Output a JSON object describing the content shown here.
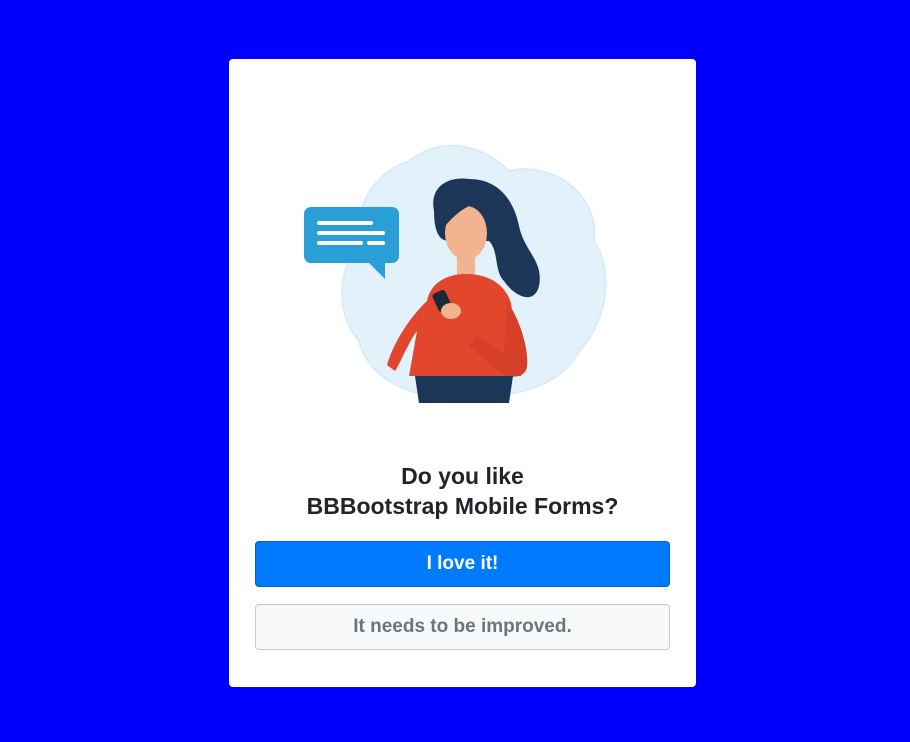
{
  "colors": {
    "background": "#0000ff",
    "card": "#ffffff",
    "primary_button": "#007bff",
    "secondary_button": "#f8f9fa",
    "text": "#212529"
  },
  "illustration": {
    "icon": "woman-with-phone-and-chat-bubble-illustration"
  },
  "question": {
    "line1": "Do you like",
    "line2": "BBBootstrap Mobile Forms?"
  },
  "actions": {
    "positive_label": "I love it!",
    "negative_label": "It needs to be improved."
  }
}
